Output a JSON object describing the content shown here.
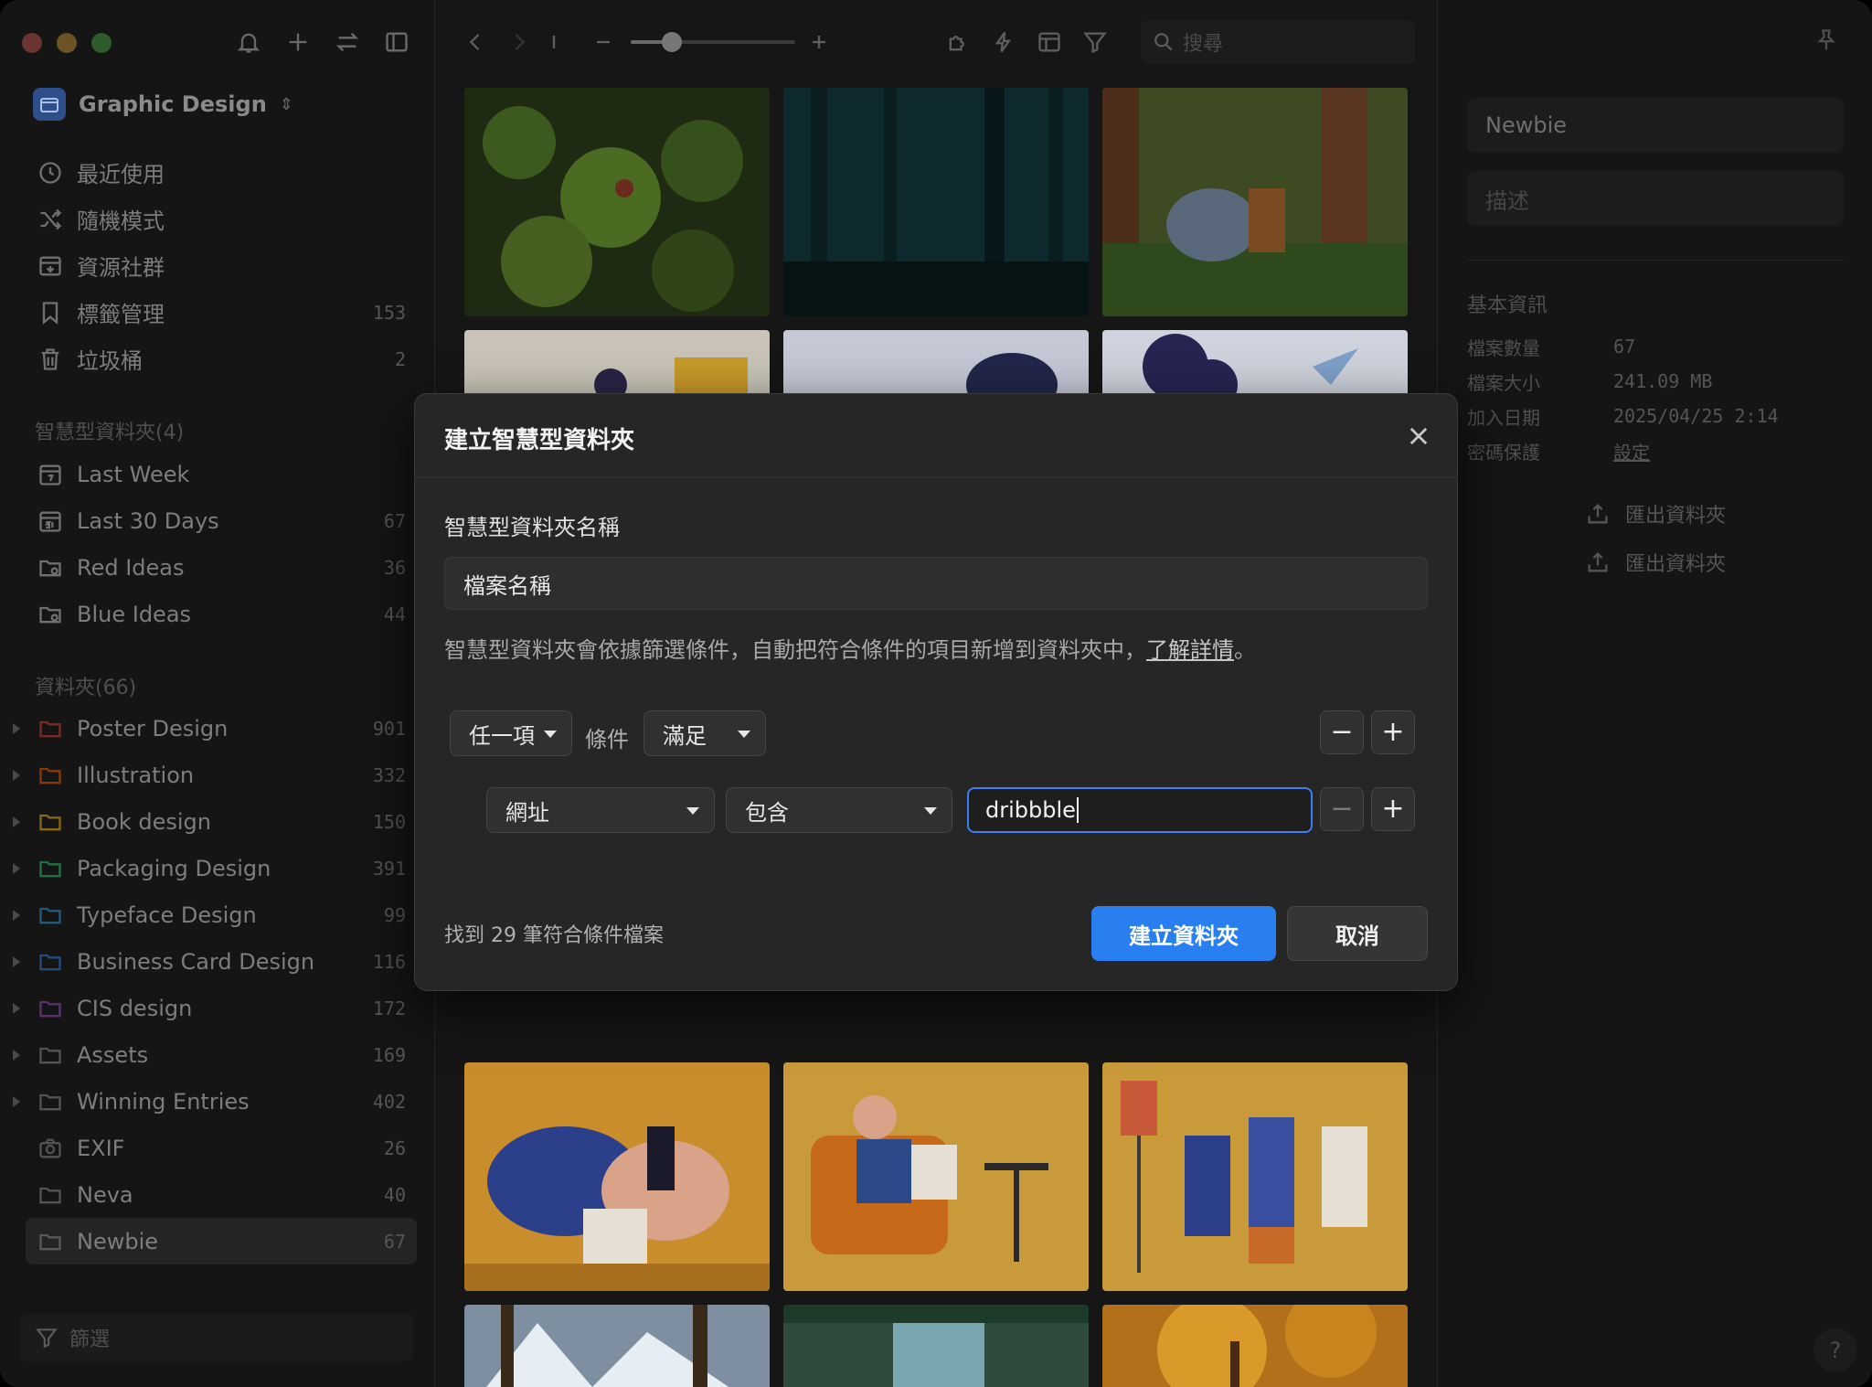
{
  "sidebar": {
    "library_name": "Graphic Design",
    "nav": [
      {
        "label": "最近使用",
        "count": ""
      },
      {
        "label": "隨機模式",
        "count": ""
      },
      {
        "label": "資源社群",
        "count": ""
      },
      {
        "label": "標籤管理",
        "count": "153"
      },
      {
        "label": "垃圾桶",
        "count": "2"
      }
    ],
    "smart_section": "智慧型資料夾(4)",
    "smart": [
      {
        "label": "Last Week",
        "count": ""
      },
      {
        "label": "Last 30 Days",
        "count": "67"
      },
      {
        "label": "Red Ideas",
        "count": "36"
      },
      {
        "label": "Blue Ideas",
        "count": "44"
      }
    ],
    "folder_section": "資料夾(66)",
    "folders": [
      {
        "label": "Poster Design",
        "count": "901",
        "color": "#c0392b"
      },
      {
        "label": "Illustration",
        "count": "332",
        "color": "#d35400"
      },
      {
        "label": "Book design",
        "count": "150",
        "color": "#d4a017"
      },
      {
        "label": "Packaging Design",
        "count": "391",
        "color": "#27ae60"
      },
      {
        "label": "Typeface Design",
        "count": "99",
        "color": "#2e86c1"
      },
      {
        "label": "Business Card Design",
        "count": "116",
        "color": "#2e6fc1"
      },
      {
        "label": "CIS design",
        "count": "172",
        "color": "#8e44ad"
      },
      {
        "label": "Assets",
        "count": "169",
        "color": "#7d7d7d"
      },
      {
        "label": "Winning Entries",
        "count": "402",
        "color": "#7d7d7d"
      },
      {
        "label": "EXIF",
        "count": "26",
        "color": "#7d7d7d"
      },
      {
        "label": "Neva",
        "count": "40",
        "color": "#7d7d7d"
      },
      {
        "label": "Newbie",
        "count": "67",
        "color": "#7d7d7d"
      }
    ],
    "filter_label": "篩選"
  },
  "toolbar": {
    "search_placeholder": "搜尋",
    "zoom_level": 0.25
  },
  "inspector": {
    "name": "Newbie",
    "description_placeholder": "描述",
    "section_title": "基本資訊",
    "info": [
      {
        "key": "檔案數量",
        "value": "67"
      },
      {
        "key": "檔案大小",
        "value": "241.09 MB"
      },
      {
        "key": "加入日期",
        "value": "2025/04/25 2:14"
      },
      {
        "key": "密碼保護",
        "value": "設定"
      }
    ],
    "export_1": "匯出資料夾",
    "export_2": "匯出資料夾",
    "help": "?"
  },
  "dialog": {
    "title": "建立智慧型資料夾",
    "name_label": "智慧型資料夾名稱",
    "name_value": "檔案名稱",
    "help_text": "智慧型資料夾會依據篩選條件，自動把符合條件的項目新增到資料夾中，",
    "help_link": "了解詳情",
    "help_end": "。",
    "match_select": "任一項",
    "condition_label": "條件",
    "condition_select": "滿足",
    "field_select": "網址",
    "operator_select": "包含",
    "value": "dribbble",
    "result_text": "找到 29 筆符合條件檔案",
    "create_label": "建立資料夾",
    "cancel_label": "取消",
    "minus": "−",
    "plus": "+"
  },
  "colors": {
    "accent": "#2a7ff0",
    "dialog_bg": "#262626",
    "sidebar_bg": "#151515"
  }
}
